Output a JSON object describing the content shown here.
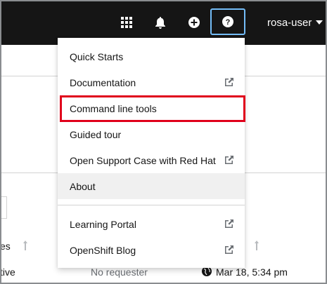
{
  "masthead": {
    "username": "rosa-user",
    "icons": [
      "grid-icon",
      "bell-icon",
      "plus-circle-icon",
      "question-circle-icon"
    ]
  },
  "help_menu": {
    "items": [
      {
        "label": "Quick Starts",
        "external": false
      },
      {
        "label": "Documentation",
        "external": true
      },
      {
        "label": "Command line tools",
        "external": false,
        "highlighted": true
      },
      {
        "label": "Guided tour",
        "external": false
      },
      {
        "label": "Open Support Case with Red Hat",
        "external": true
      },
      {
        "label": "About",
        "external": false,
        "hovered": true
      },
      {
        "label": "Learning Portal",
        "external": true
      },
      {
        "label": "OpenShift Blog",
        "external": true
      }
    ]
  },
  "background_page": {
    "column_header_fragment": "es",
    "row": {
      "status_fragment": "tive",
      "requester": "No requester",
      "date": "Mar 18, 5:34 pm"
    }
  },
  "colors": {
    "masthead_bg": "#151515",
    "highlight": "#e0001b",
    "focus_ring": "#73bcf7",
    "hover_bg": "#f0f0f0"
  }
}
